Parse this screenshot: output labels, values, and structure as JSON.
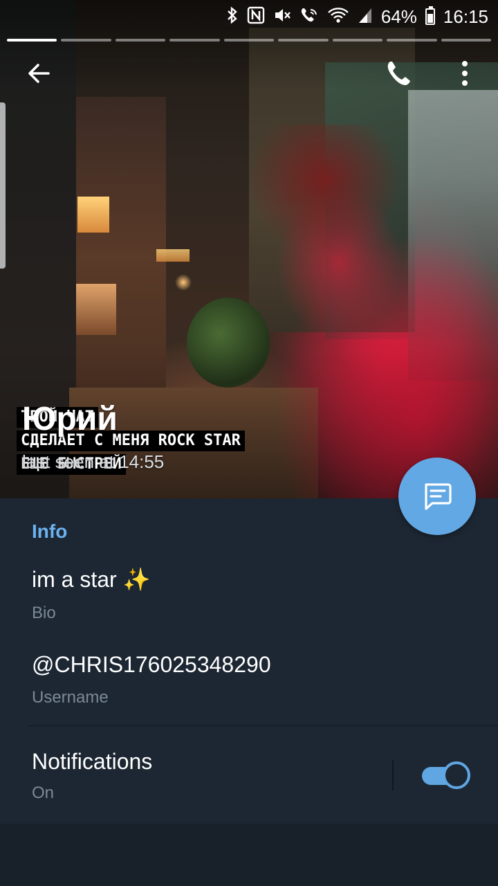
{
  "status_bar": {
    "icons": [
      "bluetooth-icon",
      "nfc-icon",
      "mute-icon",
      "wifi-calling-icon",
      "wifi-icon",
      "signal-icon",
      "battery-icon"
    ],
    "battery": "64%",
    "time": "16:15"
  },
  "story_progress": {
    "segments": 9,
    "active_index": 0
  },
  "toolbar": {
    "back_icon": "arrow-left-icon",
    "call_icon": "phone-icon",
    "menu_icon": "more-vert-icon"
  },
  "photo_caption": {
    "lines": [
      "ТВОЙ ЧАТ",
      "СДЕЛАЕТ С МЕНЯ ROCK STAR",
      "ЕЩЕ БЫСТРЕЙ"
    ]
  },
  "profile": {
    "name": "Юрий",
    "last_seen": "last seen at 14:55"
  },
  "info": {
    "title": "Info",
    "bio": {
      "value": "im a star ✨",
      "label": "Bio"
    },
    "username": {
      "value": "@CHRIS176025348290",
      "label": "Username"
    },
    "notifications": {
      "label": "Notifications",
      "value": "On",
      "enabled": true
    }
  },
  "fab": {
    "icon": "message-icon"
  },
  "colors": {
    "accent": "#62a8e4",
    "section_title": "#6bb2f0",
    "panel_bg": "#1d2733",
    "secondary_text": "#7c8996"
  }
}
